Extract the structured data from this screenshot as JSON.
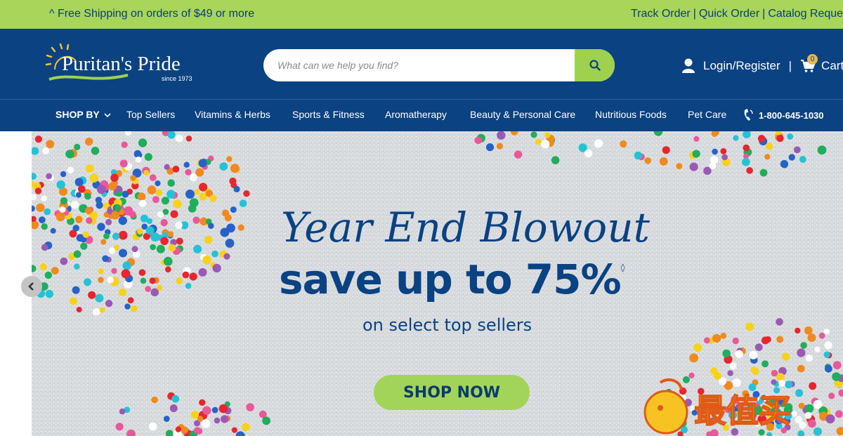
{
  "topbar": {
    "shipping": "^ Free Shipping on orders of $49 or more",
    "links": [
      "Track Order",
      "Quick Order",
      "Catalog Reques"
    ]
  },
  "brand": {
    "name": "Puritan's Pride",
    "since": "since 1973"
  },
  "search": {
    "placeholder": "What can we help you find?",
    "value": "",
    "icon": "search-icon"
  },
  "account": {
    "login_label": "Login/Register",
    "cart_label": "Cart",
    "cart_count": "0"
  },
  "nav": {
    "shop_by": "SHOP BY",
    "items": [
      "Top Sellers",
      "Vitamins & Herbs",
      "Sports & Fitness",
      "Aromatherapy",
      "Beauty & Personal Care",
      "Nutritious Foods",
      "Pet Care"
    ],
    "phone": "1-800-645-1030"
  },
  "hero": {
    "headline": "Year End Blowout",
    "offer": "save up to 75%",
    "offer_mark": "◊",
    "tagline": "on select top sellers",
    "cta": "SHOP NOW"
  },
  "watermark": {
    "text": "最值买"
  },
  "colors": {
    "topbar": "#a8d55a",
    "navy": "#0a4282",
    "accent_green": "#9fd14f"
  }
}
